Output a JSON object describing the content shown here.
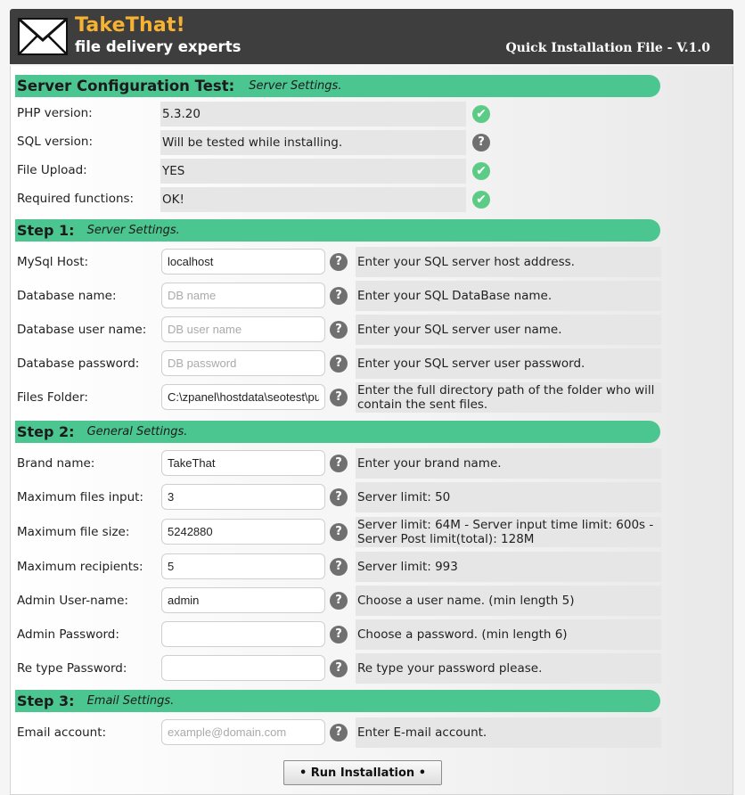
{
  "header": {
    "brand_title": "TakeThat!",
    "brand_subtitle": "file delivery experts",
    "version": "Quick Installation File - V.1.0"
  },
  "server_test": {
    "title": "Server Configuration Test:",
    "subtitle": "Server Settings.",
    "rows": [
      {
        "label": "PHP version:",
        "value": "5.3.20",
        "status": "ok"
      },
      {
        "label": "SQL version:",
        "value": "Will be tested while installing.",
        "status": "unknown"
      },
      {
        "label": "File Upload:",
        "value": "YES",
        "status": "ok"
      },
      {
        "label": "Required functions:",
        "value": "OK!",
        "status": "ok"
      }
    ]
  },
  "step1": {
    "title": "Step 1:",
    "subtitle": "Server Settings.",
    "fields": [
      {
        "label": "MySql Host:",
        "value": "localhost",
        "placeholder": "",
        "help": "Enter your SQL server host address."
      },
      {
        "label": "Database name:",
        "value": "",
        "placeholder": "DB name",
        "help": "Enter your SQL DataBase name."
      },
      {
        "label": "Database user name:",
        "value": "",
        "placeholder": "DB user name",
        "help": "Enter your SQL server user name."
      },
      {
        "label": "Database password:",
        "value": "",
        "placeholder": "DB password",
        "help": "Enter your SQL server user password."
      },
      {
        "label": "Files Folder:",
        "value": "C:\\zpanel\\hostdata\\seotest\\pu",
        "placeholder": "",
        "help": "Enter the full directory path of the folder who will contain the sent files."
      }
    ]
  },
  "step2": {
    "title": "Step 2:",
    "subtitle": "General Settings.",
    "fields": [
      {
        "label": "Brand name:",
        "value": "TakeThat",
        "placeholder": "",
        "help": "Enter your brand name."
      },
      {
        "label": "Maximum files input:",
        "value": "3",
        "placeholder": "",
        "help": "Server limit: 50"
      },
      {
        "label": "Maximum file size:",
        "value": "5242880",
        "placeholder": "",
        "help": "Server limit: 64M - Server input time limit: 600s - Server Post limit(total): 128M"
      },
      {
        "label": "Maximum recipients:",
        "value": "5",
        "placeholder": "",
        "help": "Server limit: 993"
      },
      {
        "label": "Admin User-name:",
        "value": "admin",
        "placeholder": "",
        "help": "Choose a user name. (min length 5)"
      },
      {
        "label": "Admin Password:",
        "value": "",
        "placeholder": "",
        "help": "Choose a password. (min length 6)"
      },
      {
        "label": "Re type Password:",
        "value": "",
        "placeholder": "",
        "help": "Re type your password please."
      }
    ]
  },
  "step3": {
    "title": "Step 3:",
    "subtitle": "Email Settings.",
    "fields": [
      {
        "label": "Email account:",
        "value": "",
        "placeholder": "example@domain.com",
        "help": "Enter E-mail account."
      }
    ]
  },
  "run_button_label": "• Run Installation •",
  "icons": {
    "ok": "checkmark-icon",
    "unknown": "question-icon",
    "help": "question-icon"
  },
  "colors": {
    "header_bg": "#3e3e3e",
    "brand_orange": "#f7b232",
    "section_green": "#4cc690",
    "ok_green": "#5ccb86",
    "help_gray": "#707070"
  }
}
